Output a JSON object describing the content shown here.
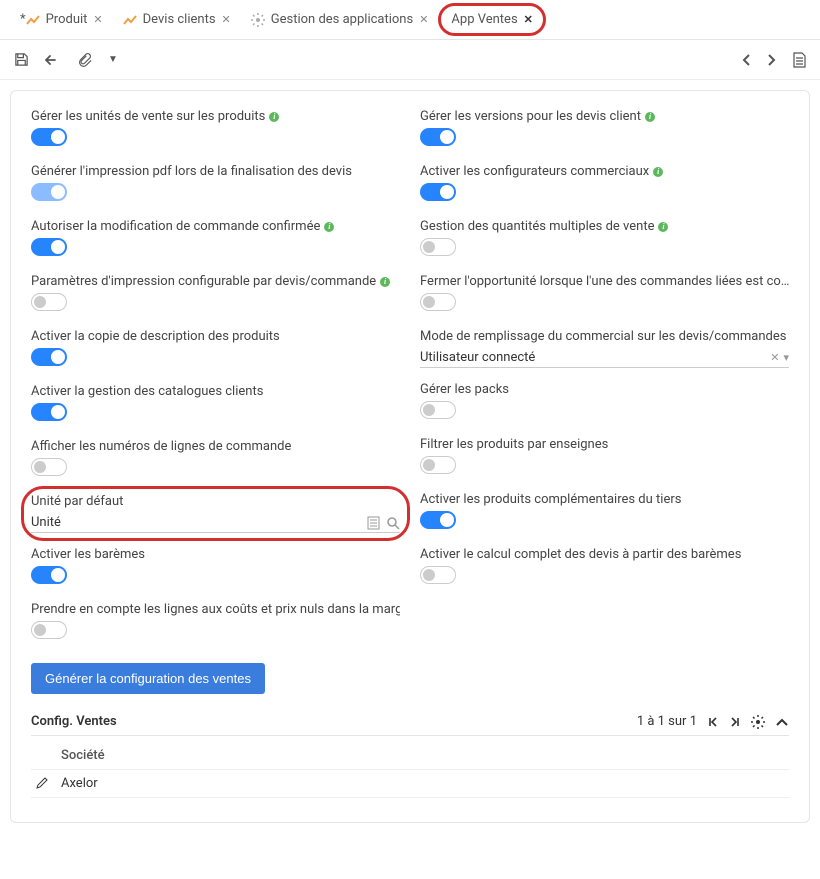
{
  "tabs": [
    {
      "label": "Produit",
      "icon": "chart",
      "prefix": "*"
    },
    {
      "label": "Devis clients",
      "icon": "chart",
      "prefix": ""
    },
    {
      "label": "Gestion des applications",
      "icon": "gear",
      "prefix": ""
    },
    {
      "label": "App Ventes",
      "icon": "",
      "prefix": "",
      "active": true,
      "highlighted": true
    }
  ],
  "left": [
    {
      "label": "Gérer les unités de vente sur les produits",
      "info": true,
      "type": "toggle",
      "on": true
    },
    {
      "label": "Générer l'impression pdf lors de la finalisation des devis",
      "info": false,
      "type": "toggle",
      "on": true,
      "dim": true
    },
    {
      "label": "Autoriser la modification de commande confirmée",
      "info": true,
      "type": "toggle",
      "on": true
    },
    {
      "label": "Paramètres d'impression configurable par devis/commande",
      "info": true,
      "type": "toggle",
      "on": false
    },
    {
      "label": "Activer la copie de description des produits",
      "info": false,
      "type": "toggle",
      "on": true
    },
    {
      "label": "Activer la gestion des catalogues clients",
      "info": false,
      "type": "toggle",
      "on": true
    },
    {
      "label": "Afficher les numéros de lignes de commande",
      "info": false,
      "type": "toggle",
      "on": false
    },
    {
      "label": "Unité par défaut",
      "info": false,
      "type": "lookup",
      "value": "Unité",
      "highlighted": true
    },
    {
      "label": "Activer les barèmes",
      "info": false,
      "type": "toggle",
      "on": true
    },
    {
      "label": "Prendre en compte les lignes aux coûts et prix nuls dans la marge",
      "info": true,
      "type": "toggle",
      "on": false
    }
  ],
  "right": [
    {
      "label": "Gérer les versions pour les devis client",
      "info": true,
      "type": "toggle",
      "on": true
    },
    {
      "label": "Activer les configurateurs commerciaux",
      "info": true,
      "type": "toggle",
      "on": true
    },
    {
      "label": "Gestion des quantités multiples de vente",
      "info": true,
      "type": "toggle",
      "on": false
    },
    {
      "label": "Fermer l'opportunité lorsque l'une des commandes liées est co…",
      "info": true,
      "type": "toggle",
      "on": false
    },
    {
      "label": "Mode de remplissage du commercial sur les devis/commandes",
      "info": false,
      "type": "select",
      "value": "Utilisateur connecté"
    },
    {
      "label": "Gérer les packs",
      "info": false,
      "type": "toggle",
      "on": false
    },
    {
      "label": "Filtrer les produits par enseignes",
      "info": false,
      "type": "toggle",
      "on": false
    },
    {
      "label": "Activer les produits complémentaires du tiers",
      "info": false,
      "type": "toggle",
      "on": true
    },
    {
      "label": "Activer le calcul complet des devis à partir des barèmes",
      "info": false,
      "type": "toggle",
      "on": false
    }
  ],
  "button": {
    "label": "Générer la configuration des ventes"
  },
  "section": {
    "title": "Config. Ventes",
    "pager": "1 à 1 sur 1",
    "header": "Société",
    "rows": [
      "Axelor"
    ]
  }
}
